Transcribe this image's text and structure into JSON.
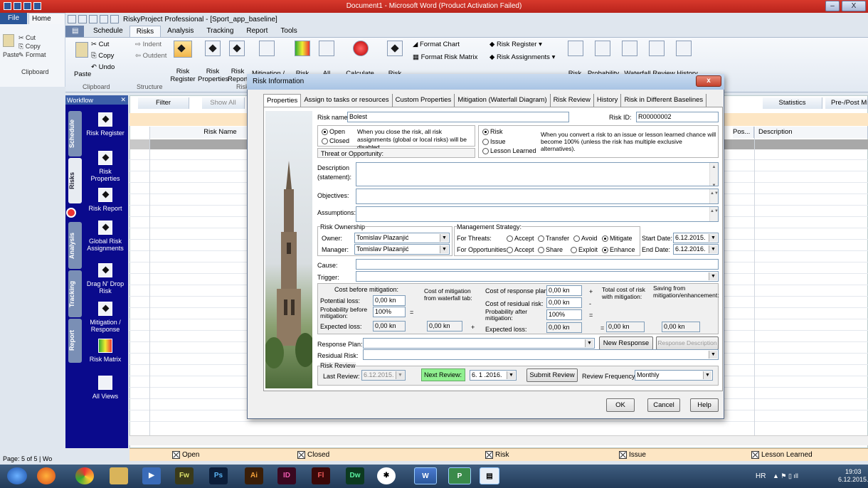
{
  "word": {
    "title": "Document1 - Microsoft Word (Product Activation Failed)",
    "file": "File",
    "home": "Home",
    "cut": "Cut",
    "copy": "Copy",
    "format": "Format",
    "paste": "Paste",
    "clipboard": "Clipboard",
    "status": "Page: 5 of 5",
    "status2": "Wo"
  },
  "app": {
    "title": "RiskyProject Professional - [Sport_app_baseline]"
  },
  "ribbon": {
    "tabs": [
      "Schedule",
      "Risks",
      "Analysis",
      "Tracking",
      "Report",
      "Tools"
    ],
    "cut": "Cut",
    "copy": "Copy",
    "undo": "Undo",
    "paste": "Paste",
    "clipboard": "Clipboard",
    "indent": "Indent",
    "outdent": "Outdent",
    "structure": "Structure",
    "risk_register": "Risk Register",
    "risk_properties": "Risk Properties",
    "risk_report": "Risk Report",
    "risk_view": "Risk Vi",
    "mitigation": "Mitigation /",
    "risk": "Risk",
    "all": "All",
    "calculate": "Calculate",
    "risk2": "Risk",
    "format_chart": "Format Chart",
    "format_risk_matrix": "Format Risk Matrix",
    "risk_register_dd": "Risk Register ▾",
    "risk_assignments_dd": "Risk Assignments ▾",
    "risk3": "Risk",
    "probability": "Probability",
    "waterfall": "Waterfall",
    "review": "Review",
    "history": "History"
  },
  "workflow": {
    "header": "Workflow",
    "close": "✕",
    "tabs": [
      "Schedule",
      "Risks",
      "Analysis",
      "Tracking",
      "Report"
    ],
    "items": [
      "Risk Register",
      "Risk Properties",
      "Risk Report",
      "Global Risk Assignments",
      "Drag N' Drop Risk",
      "Mitigation / Response",
      "Risk Matrix",
      "All Views"
    ]
  },
  "grid": {
    "filter": "Filter",
    "show_all": "Show All",
    "statistics": "Statistics",
    "prepost": "Pre-/Post Miti",
    "col_risk_name": "Risk Name",
    "col_pos": "Pos...",
    "col_description": "Description"
  },
  "legend": {
    "open": "Open",
    "closed": "Closed",
    "risk": "Risk",
    "issue": "Issue",
    "lesson": "Lesson Learned"
  },
  "dialog": {
    "title": "Risk Information",
    "close": "x",
    "tabs": [
      "Properties",
      "Assign to tasks or resources",
      "Custom Properties",
      "Mitigation (Waterfall Diagram)",
      "Risk Review",
      "History",
      "Risk in Different Baselines"
    ],
    "risk_name_label": "Risk name:",
    "risk_name": "Bolest",
    "risk_id_label": "Risk ID:",
    "risk_id": "R00000002",
    "open": "Open",
    "closed": "Closed",
    "status_note": "When you close the risk, all risk assignments (global or local risks) will be disabled",
    "type_risk": "Risk",
    "type_issue": "Issue",
    "type_lesson": "Lesson Learned",
    "type_note": "When you convert a risk to an issue or lesson learned chance will become 100% (unless the risk has multiple exclusive alternatives).",
    "threat": "Threat or Opportunity:",
    "description": "Description (statement):",
    "objectives": "Objectives:",
    "assumptions": "Assumptions:",
    "ownership": "Risk Ownership",
    "owner_label": "Owner:",
    "owner": "Tomislav Plazanjić",
    "manager_label": "Manager:",
    "manager": "Tomislav Plazanjić",
    "strategy": "Management Strategy:",
    "for_threats": "For Threats:",
    "accept": "Accept",
    "transfer": "Transfer",
    "avoid": "Avoid",
    "mitigate": "Mitigate",
    "for_opps": "For Opportunities:",
    "share": "Share",
    "exploit": "Exploit",
    "enhance": "Enhance",
    "start_date_label": "Start Date:",
    "start_date": "6.12.2015.",
    "end_date_label": "End Date:",
    "end_date": "6.12.2016.",
    "cause": "Cause:",
    "trigger": "Trigger:",
    "cost_before": "Cost before mitigation:",
    "potential_loss": "Potential loss:",
    "potential_loss_v": "0,00 kn",
    "prob_before": "Probability before mitigation:",
    "prob_before_v": "100%",
    "expected_loss": "Expected loss:",
    "expected_loss_v": "0,00 kn",
    "cost_mit": "Cost of mitigation from waterfall tab:",
    "cost_mit_v": "0,00 kn",
    "cost_resp": "Cost of response plan:",
    "cost_resp_v": "0,00 kn",
    "cost_resid": "Cost of residual risk:",
    "cost_resid_v": "0,00 kn",
    "prob_after": "Probability after mitigation:",
    "prob_after_v": "100%",
    "expected_loss2": "Expected loss:",
    "expected_loss2_v": "0,00 kn",
    "total": "Total cost of risk with mitigation:",
    "total_v": "0,00 kn",
    "saving": "Saving from mitigation/enhancement:",
    "saving_v": "0,00 kn",
    "response_plan": "Response Plan:",
    "new_response": "New Response",
    "response_desc": "Response Description",
    "residual": "Residual Risk:",
    "review_group": "Risk Review",
    "last_review": "Last Review:",
    "last_review_v": "6.12.2015.",
    "next_review": "Next Review:",
    "next_review_v": "6. 1 .2016.",
    "submit_review": "Submit Review",
    "frequency": "Review Frequency:",
    "frequency_v": "Monthly",
    "ok": "OK",
    "cancel": "Cancel",
    "help": "Help"
  },
  "taskbar": {
    "apps": [
      "Fw",
      "Ps",
      "Ai",
      "ID",
      "Fl",
      "Dw",
      "W",
      "P"
    ],
    "lang": "HR",
    "time": "19:03",
    "date": "6.12.2015."
  }
}
